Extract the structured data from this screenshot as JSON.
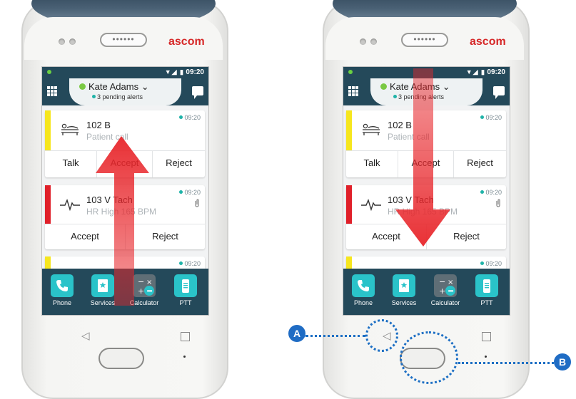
{
  "phones": [
    {
      "brand": "ascom",
      "speaker": "••••••",
      "status_time": "09:20",
      "status_icons": "▼◢ ▮",
      "user": "Kate Adams ⌄",
      "pending": "3 pending alerts",
      "alerts": [
        {
          "time": "09:20",
          "room": "102 B",
          "sub": "Patient call",
          "bar_color": "#f6e61e",
          "buttons": [
            "Talk",
            "Accept",
            "Reject"
          ]
        },
        {
          "time": "09:20",
          "room": "103 V Tach",
          "sub": "HR High 165 BPM",
          "bar_color": "#e0202a",
          "buttons": [
            "Accept",
            "Reject"
          ]
        },
        {
          "time": "09:20",
          "room": "",
          "sub": "",
          "bar_color": "#f6e61e",
          "buttons": []
        }
      ],
      "dock": [
        {
          "label": "Phone",
          "icon": "phone-icon"
        },
        {
          "label": "Services",
          "icon": "services-icon"
        },
        {
          "label": "Calculator",
          "icon": "calculator-icon"
        },
        {
          "label": "PTT",
          "icon": "ptt-icon"
        }
      ],
      "gesture": "swipe-up"
    },
    {
      "brand": "ascom",
      "speaker": "••••••",
      "status_time": "09:20",
      "status_icons": "▼◢ ▮",
      "user": "Kate Adams ⌄",
      "pending": "3 pending alerts",
      "alerts": [
        {
          "time": "09:20",
          "room": "102 B",
          "sub": "Patient call",
          "bar_color": "#f6e61e",
          "buttons": [
            "Talk",
            "Accept",
            "Reject"
          ]
        },
        {
          "time": "09:20",
          "room": "103 V Tach",
          "sub": "HR High 165 BPM",
          "bar_color": "#e0202a",
          "buttons": [
            "Accept",
            "Reject"
          ]
        },
        {
          "time": "09:20",
          "room": "",
          "sub": "",
          "bar_color": "#f6e61e",
          "buttons": []
        }
      ],
      "dock": [
        {
          "label": "Phone",
          "icon": "phone-icon"
        },
        {
          "label": "Services",
          "icon": "services-icon"
        },
        {
          "label": "Calculator",
          "icon": "calculator-icon"
        },
        {
          "label": "PTT",
          "icon": "ptt-icon"
        }
      ],
      "gesture": "swipe-down"
    }
  ],
  "callouts": {
    "a": "A",
    "b": "B",
    "color": "#1d6fc4"
  },
  "arrow_color": "#e8262b",
  "dock_icon_color": "#2ac3c9"
}
